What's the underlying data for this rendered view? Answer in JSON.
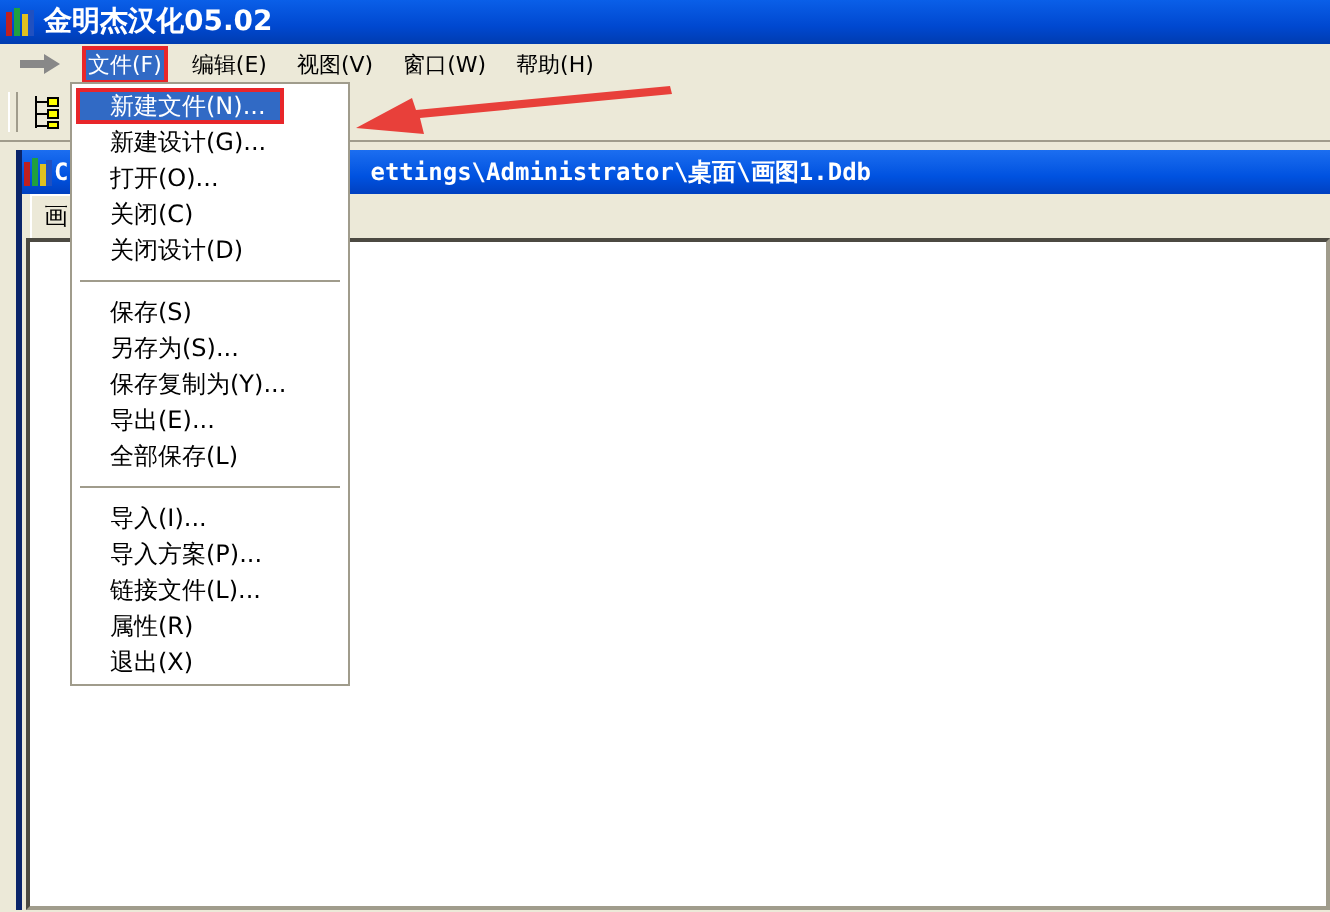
{
  "window": {
    "title": "金明杰汉化05.02"
  },
  "menubar": [
    {
      "label": "文件(F)",
      "selected": true,
      "marked": true
    },
    {
      "label": "编辑(E)",
      "selected": false,
      "marked": false
    },
    {
      "label": "视图(V)",
      "selected": false,
      "marked": false
    },
    {
      "label": "窗口(W)",
      "selected": false,
      "marked": false
    },
    {
      "label": "帮助(H)",
      "selected": false,
      "marked": false
    }
  ],
  "document": {
    "title_start": "C",
    "title_end": "ettings\\Administrator\\桌面\\画图1.Ddb",
    "tab": "画"
  },
  "file_menu": [
    {
      "kind": "item",
      "label": "新建文件(N)...",
      "selected": true,
      "marked": true
    },
    {
      "kind": "item",
      "label": "新建设计(G)...",
      "selected": false,
      "marked": false
    },
    {
      "kind": "item",
      "label": "打开(O)...",
      "selected": false,
      "marked": false
    },
    {
      "kind": "item",
      "label": "关闭(C)",
      "selected": false,
      "marked": false
    },
    {
      "kind": "item",
      "label": "关闭设计(D)",
      "selected": false,
      "marked": false
    },
    {
      "kind": "separator"
    },
    {
      "kind": "item",
      "label": "保存(S)",
      "selected": false,
      "marked": false
    },
    {
      "kind": "item",
      "label": "另存为(S)...",
      "selected": false,
      "marked": false
    },
    {
      "kind": "item",
      "label": "保存复制为(Y)...",
      "selected": false,
      "marked": false
    },
    {
      "kind": "item",
      "label": "导出(E)...",
      "selected": false,
      "marked": false
    },
    {
      "kind": "item",
      "label": "全部保存(L)",
      "selected": false,
      "marked": false
    },
    {
      "kind": "separator"
    },
    {
      "kind": "item",
      "label": "导入(I)...",
      "selected": false,
      "marked": false
    },
    {
      "kind": "item",
      "label": "导入方案(P)...",
      "selected": false,
      "marked": false
    },
    {
      "kind": "item",
      "label": "链接文件(L)...",
      "selected": false,
      "marked": false
    },
    {
      "kind": "item",
      "label": "属性(R)",
      "selected": false,
      "marked": false
    },
    {
      "kind": "item",
      "label": "退出(X)",
      "selected": false,
      "marked": false
    }
  ]
}
